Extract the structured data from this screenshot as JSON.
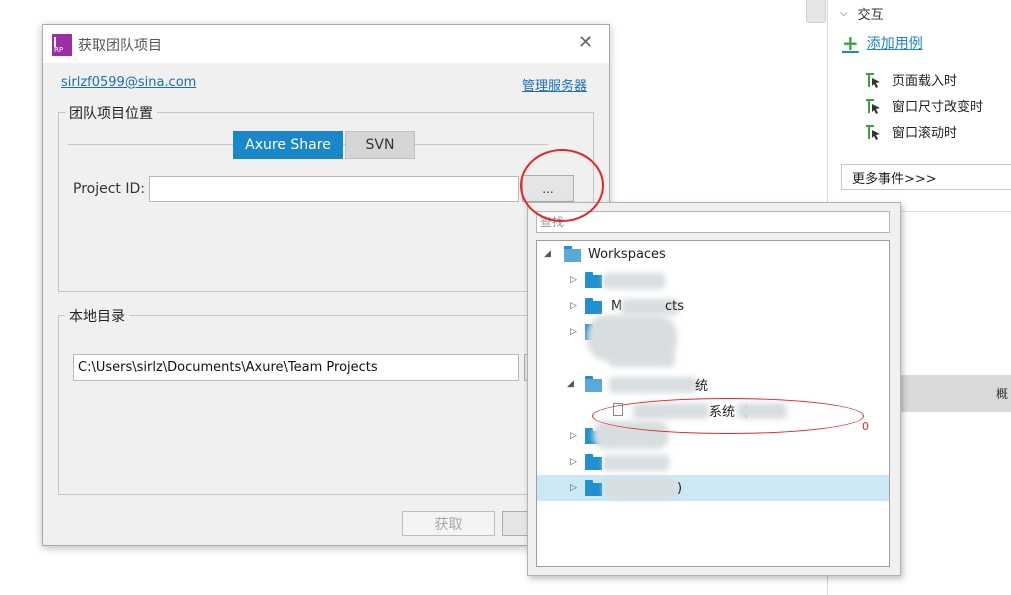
{
  "right_panel": {
    "section_label": "交互",
    "add_case_label": "添加用例",
    "events": [
      "页面载入时",
      "窗口尺寸改变时",
      "窗口滚动时"
    ],
    "more_events_label": "更多事件>>>",
    "gray_bar_text": "概"
  },
  "dialog": {
    "title": "获取团队项目",
    "account_link": "sirlzf0599@sina.com",
    "manage_server_link": "管理服务器",
    "location_group_label": "团队项目位置",
    "tabs": [
      {
        "label": "Axure Share",
        "active": true
      },
      {
        "label": "SVN",
        "active": false
      }
    ],
    "project_id_label": "Project ID:",
    "project_id_value": "",
    "browse_button_label": "...",
    "local_dir_group_label": "本地目录",
    "local_dir_value": "C:\\Users\\sirlz\\Documents\\Axure\\Team Projects",
    "get_button_label": "获取"
  },
  "popup": {
    "search_placeholder": "查找",
    "tree": {
      "root_label": "Workspaces",
      "item_2_label_partial": "M",
      "item_2_label_suffix": "cts",
      "item_5_suffix": "统",
      "file_label_partial": "系统（",
      "last_item_suffix": ")"
    }
  },
  "colors": {
    "accent": "#1a87c9",
    "annotation_red": "#e3262a",
    "folder_blue": "#1f90d0",
    "selection": "#cce8f4"
  }
}
